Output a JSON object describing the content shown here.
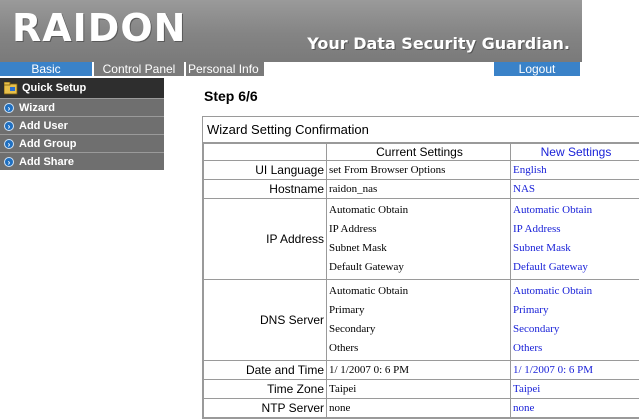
{
  "header": {
    "logo": "RAIDON",
    "tagline": "Your Data Security Guardian."
  },
  "nav": {
    "basic": "Basic",
    "control_panel": "Control Panel",
    "personal_info": "Personal Info",
    "logout": "Logout"
  },
  "sidebar": {
    "header": "Quick Setup",
    "items": [
      {
        "label": "Wizard"
      },
      {
        "label": "Add User"
      },
      {
        "label": "Add Group"
      },
      {
        "label": "Add Share"
      }
    ]
  },
  "main": {
    "step": "Step 6/6",
    "panel_title": "Wizard Setting Confirmation",
    "col_current": "Current Settings",
    "col_new": "New Settings",
    "rows": {
      "ui_language": {
        "label": "UI Language",
        "current": "set From Browser Options",
        "new": "English"
      },
      "hostname": {
        "label": "Hostname",
        "current": "raidon_nas",
        "new": "NAS"
      },
      "ip_address": {
        "label": "IP Address",
        "current": [
          "Automatic Obtain",
          "IP Address",
          "Subnet Mask",
          "Default Gateway"
        ],
        "new": [
          "Automatic Obtain",
          "IP Address",
          "Subnet Mask",
          "Default Gateway"
        ]
      },
      "dns_server": {
        "label": "DNS Server",
        "current": [
          "Automatic Obtain",
          "Primary",
          "Secondary",
          "Others"
        ],
        "new": [
          "Automatic Obtain",
          "Primary",
          "Secondary",
          "Others"
        ]
      },
      "date_time": {
        "label": "Date and Time",
        "current": "1/ 1/2007 0: 6 PM",
        "new": "1/ 1/2007 0: 6 PM"
      },
      "time_zone": {
        "label": "Time Zone",
        "current": "Taipei",
        "new": "Taipei"
      },
      "ntp_server": {
        "label": "NTP Server",
        "current": "none",
        "new": "none"
      }
    }
  },
  "colors": {
    "nav_active": "#3a82c8",
    "nav_inactive": "#7a7a7a",
    "sidebar_header": "#2e2e2e",
    "sidebar_item": "#6f6f6f",
    "new_value_text": "#1a22d8"
  }
}
